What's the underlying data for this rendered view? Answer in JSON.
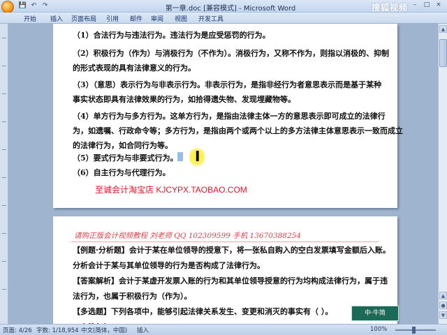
{
  "titlebar": {
    "title": "第一章.doc [兼容模式] - Microsoft Word",
    "watermark": "搜狐视频",
    "qat": [
      "save-icon",
      "undo-icon",
      "redo-icon"
    ],
    "min": "–",
    "max": "□",
    "close": "×"
  },
  "ribbon": {
    "tabs": [
      "开始",
      "插入",
      "页面布局",
      "引用",
      "邮件",
      "审阅",
      "视图",
      "开发工具"
    ]
  },
  "page1": {
    "lines": [
      "（1）合法行为与违法行为。违法行为是应受惩罚的行为。",
      "（2）积极行为（作为）与消极行为（不作为）。消极行为，又称不作为，则指以消极的、抑制",
      "的形式表现的具有法律意义的行为。",
      "（3）（意思）表示行为与非表示行为。非表示行为，是指非经行为者意思表示而是基于某种",
      "事实状态即具有法律效果的行为，如拾得遗失物、发现埋藏物等。",
      "（4）单方行为与多方行为。这单方行为，是指由法律主体一方的意思表示即可成立的法律行",
      "为，如遗嘱、行政命令等；多方行为，是指由两个或两个以上的多方法律主体意思表示一致而成立",
      "的法律行为，如合同行为等。",
      "（5）要式行为与非要式行为。",
      "（6）自主行为与代理行为。"
    ],
    "link": "至诚会计淘宝店   KJCYPX.TAOBAO.COM"
  },
  "page2": {
    "ad": "请购正版会计视频教程     刘老师 QQ 102309599     手机 13670388254",
    "lines": [
      "【例题·分析题】会计于某在单位领导的授意下，将一张私自购入的空白发票填写金额后入账。",
      "分析会计于某与其单位领导的行为是否构成了法律行为。",
      "【答案解析】会计于某虚开发票入账的行为和其单位领导授意的行为均构成法律行为，属于违",
      "法行为，也属于积极行为（作为）。",
      "【多选题】下列各项中，能够引起法律关系发生、变更和消灭的事实有（  ）。",
      "A.自然灾害"
    ]
  },
  "logo": "中·牛简",
  "status": {
    "page": "页面: 4/26",
    "words": "字数: 1/18,954",
    "lang": "中文(简体，中国)",
    "mode": "插入",
    "zoom": "100%"
  }
}
